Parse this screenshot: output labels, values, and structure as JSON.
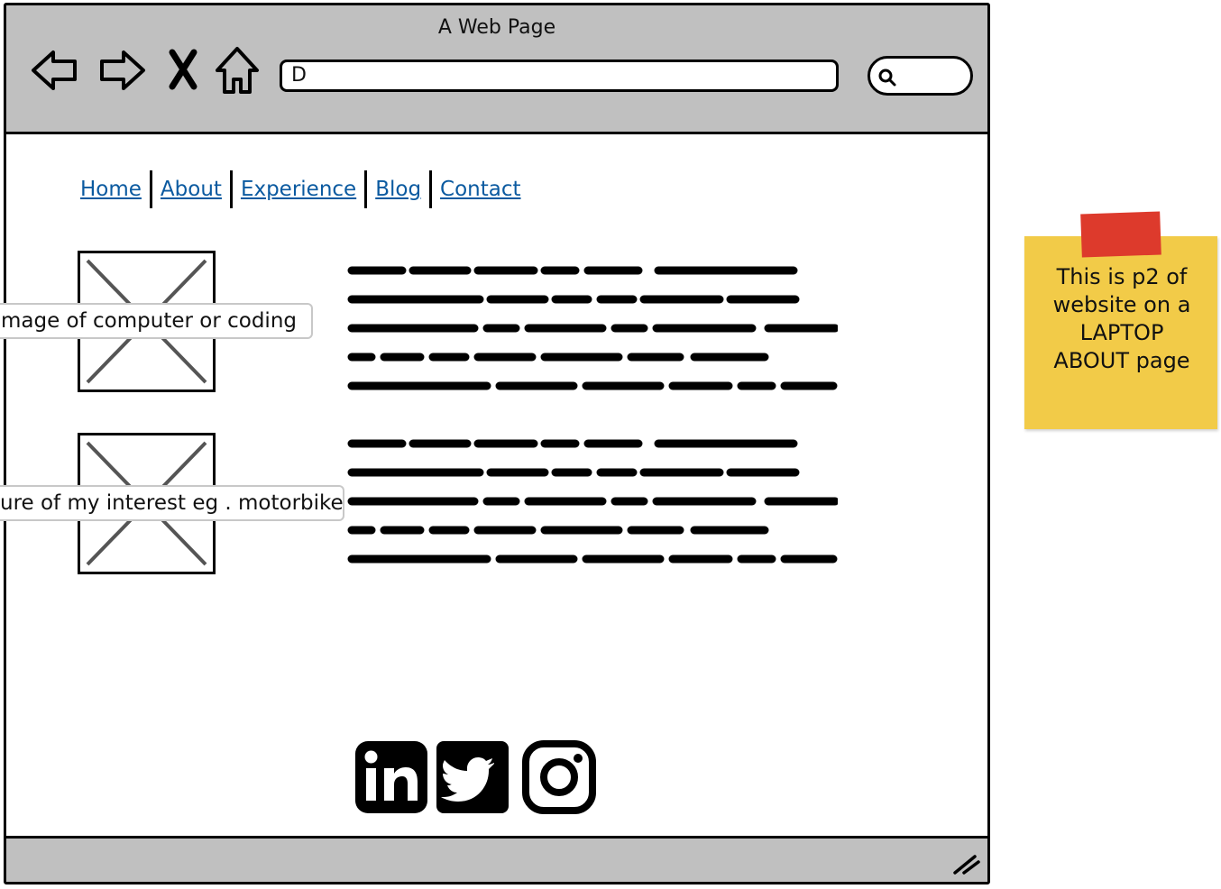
{
  "window": {
    "title": "A Web Page",
    "url": "D"
  },
  "toolbar": {
    "back": "back-icon",
    "forward": "forward-icon",
    "stop": "close-icon",
    "home": "home-icon",
    "search": "search-icon"
  },
  "nav": {
    "items": [
      {
        "label": "Home"
      },
      {
        "label": "About"
      },
      {
        "label": "Experience"
      },
      {
        "label": "Blog"
      },
      {
        "label": "Contact"
      }
    ],
    "link_color": "#0b5aa0"
  },
  "content": {
    "blocks": [
      {
        "image_tooltip": "mage of computer or coding"
      },
      {
        "image_tooltip": "ure of my interest eg . motorbike"
      }
    ]
  },
  "social": {
    "icons": [
      "linkedin-icon",
      "twitter-icon",
      "instagram-icon"
    ]
  },
  "sticky_note": {
    "text_lines": [
      "This is p2 of",
      "website on a",
      "LAPTOP",
      "ABOUT page"
    ],
    "color": "#f2cb48",
    "tape_color": "#dd3a2c"
  }
}
